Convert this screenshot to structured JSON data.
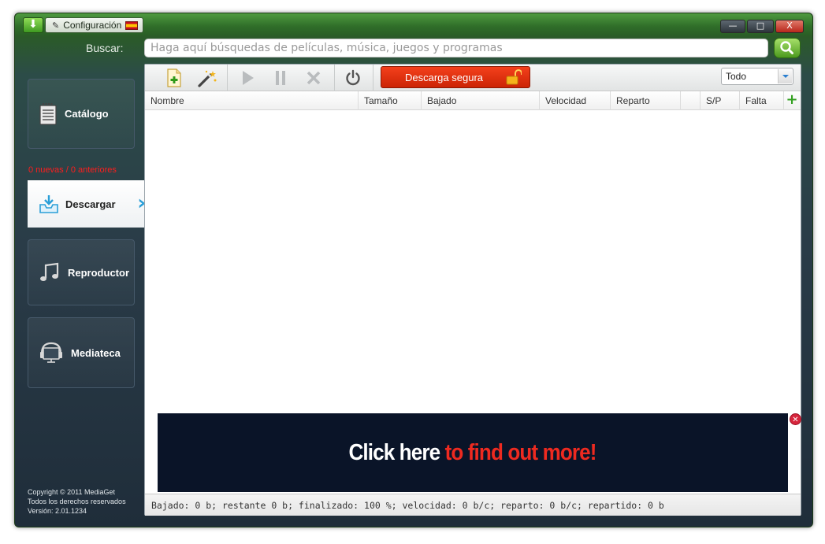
{
  "window": {
    "settings_label": "Configuración",
    "language_flag": "flag-es",
    "controls": {
      "minimize": "—",
      "maximize": "□",
      "close": "X"
    }
  },
  "search": {
    "label": "Buscar:",
    "placeholder": "Haga aquí búsquedas de películas, música, juegos y programas",
    "value": ""
  },
  "sidebar": {
    "items": [
      {
        "id": "catalog",
        "label": "Catálogo",
        "icon": "notepad-icon"
      },
      {
        "id": "download",
        "label": "Descargar",
        "icon": "download-tray-icon",
        "counts": "0 nuevas / 0 anteriores",
        "active": true
      },
      {
        "id": "player",
        "label": "Reproductor",
        "icon": "music-note-icon"
      },
      {
        "id": "library",
        "label": "Mediateca",
        "icon": "monitor-headphones-icon"
      }
    ],
    "copyright": [
      "Copyright © 2011 MediaGet",
      "Todos los derechos reservados",
      "Versión: 2.01.1234"
    ]
  },
  "toolbar": {
    "buttons": [
      "add-file-icon",
      "magic-wand-icon",
      "play-icon",
      "pause-icon",
      "stop-icon",
      "power-icon"
    ],
    "secure_download_label": "Descarga segura",
    "filter": {
      "selected": "Todo"
    }
  },
  "table": {
    "columns": [
      "Nombre",
      "Tamaño",
      "Bajado",
      "Velocidad",
      "Reparto",
      "",
      "S/P",
      "Falta"
    ],
    "rows": []
  },
  "ad": {
    "text_white": "Click here",
    "text_red": "to find out more!"
  },
  "status": {
    "text": "Bajado: 0 b; restante 0 b; finalizado: 100 %; velocidad: 0 b/c; reparto: 0 b/c; repartido: 0 b"
  },
  "colors": {
    "accent_green": "#4c9a1e",
    "secure_red": "#e0320f",
    "download_counts": "#ff1d1d",
    "ad_background": "#0a1428"
  }
}
